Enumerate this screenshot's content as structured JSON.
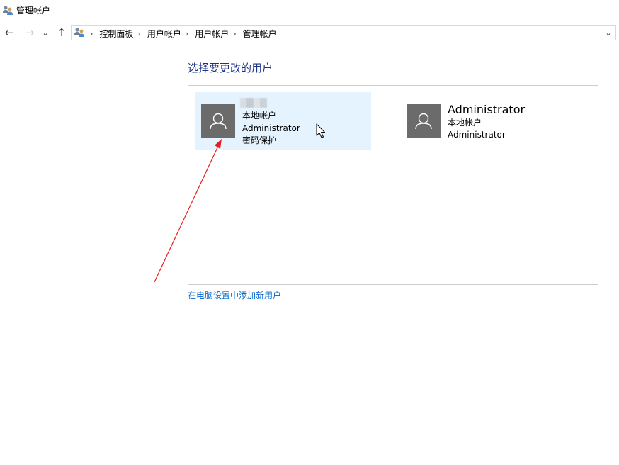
{
  "window": {
    "title": "管理帐户",
    "icon": "users-icon"
  },
  "nav": {
    "back": "←",
    "forward": "→",
    "recent": "⌄",
    "up": "↑",
    "address_icon": "control-panel-users-icon",
    "breadcrumbs": [
      "控制面板",
      "用户帐户",
      "用户帐户",
      "管理帐户"
    ],
    "separator": "›",
    "dropdown": "⌄"
  },
  "main": {
    "heading": "选择要更改的用户",
    "accounts": [
      {
        "name": "",
        "name_obscured": true,
        "lines": [
          "本地帐户",
          "Administrator",
          "密码保护"
        ],
        "selected": true
      },
      {
        "name": "Administrator",
        "name_obscured": false,
        "lines": [
          "本地帐户",
          "Administrator"
        ],
        "selected": false
      }
    ],
    "add_user_link": "在电脑设置中添加新用户"
  },
  "colors": {
    "heading": "#1e3287",
    "link": "#0066cc",
    "selected_card": "#e5f3ff",
    "avatar": "#6b6b6b",
    "annotation_arrow": "#e0201b"
  }
}
